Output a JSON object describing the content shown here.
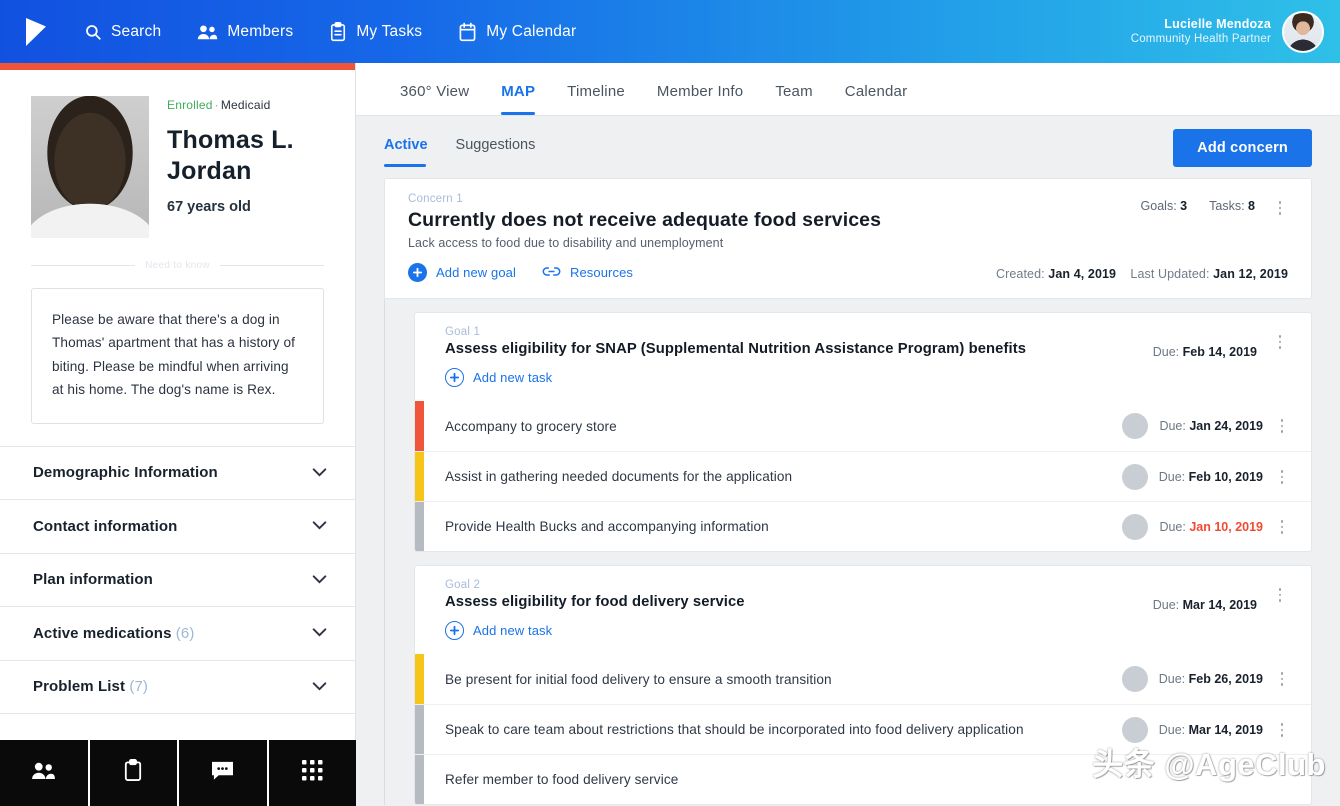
{
  "header": {
    "logo_icon": "flag-logo-icon",
    "nav": [
      {
        "label": "Search",
        "icon": "search-icon"
      },
      {
        "label": "Members",
        "icon": "members-icon"
      },
      {
        "label": "My Tasks",
        "icon": "clipboard-icon"
      },
      {
        "label": "My Calendar",
        "icon": "calendar-icon"
      }
    ],
    "user": {
      "name": "Lucielle Mendoza",
      "role": "Community Health Partner",
      "avatar": "user-avatar"
    },
    "gradient_start": "#1251e0",
    "gradient_end": "#2fc0e8"
  },
  "sidebar": {
    "accent_bar_color": "#f0543a",
    "profile": {
      "status": "Enrolled",
      "separator": "·",
      "plan": "Medicaid",
      "name": "Thomas L. Jordan",
      "age": "67 years old",
      "photo_alt": "member-photo"
    },
    "divider_label": "Need to know",
    "note": "Please be aware that there's a dog in Thomas' apartment that has a history of biting. Please be mindful when arriving at his home. The dog's name is Rex.",
    "accordion": [
      {
        "label": "Demographic Information",
        "count": ""
      },
      {
        "label": "Contact information",
        "count": ""
      },
      {
        "label": "Plan information",
        "count": ""
      },
      {
        "label": "Active medications",
        "count": "(6)"
      },
      {
        "label": "Problem List",
        "count": "(7)"
      }
    ],
    "bottom_nav": [
      {
        "icon": "members-icon"
      },
      {
        "icon": "clipboard-icon"
      },
      {
        "icon": "chat-icon"
      },
      {
        "icon": "grid-icon"
      }
    ]
  },
  "main": {
    "tabs": [
      {
        "label": "360° View",
        "active": false
      },
      {
        "label": "MAP",
        "active": true
      },
      {
        "label": "Timeline",
        "active": false
      },
      {
        "label": "Member Info",
        "active": false
      },
      {
        "label": "Team",
        "active": false
      },
      {
        "label": "Calendar",
        "active": false
      }
    ],
    "subtabs": [
      {
        "label": "Active",
        "active": true
      },
      {
        "label": "Suggestions",
        "active": false
      }
    ],
    "add_concern_label": "Add concern",
    "concern": {
      "kicker": "Concern 1",
      "title": "Currently does not receive adequate food services",
      "subtitle": "Lack access to food due to disability and unemployment",
      "add_goal_label": "Add new goal",
      "resources_label": "Resources",
      "goals_label": "Goals:",
      "goals_count": "3",
      "tasks_label": "Tasks:",
      "tasks_count": "8",
      "created_label": "Created:",
      "created_date": "Jan 4, 2019",
      "updated_label": "Last Updated:",
      "updated_date": "Jan 12, 2019"
    },
    "goals": [
      {
        "kicker": "Goal 1",
        "title": "Assess eligibility for SNAP (Supplemental Nutrition Assistance Program) benefits",
        "due_label": "Due:",
        "due_date": "Feb 14, 2019",
        "add_task_label": "Add new task",
        "tasks": [
          {
            "text": "Accompany to grocery store",
            "due_label": "Due:",
            "due_date": "Jan 24, 2019",
            "bar_color": "#f0543a",
            "overdue": false,
            "shirt": "#6b5a48"
          },
          {
            "text": "Assist in gathering needed documents for the application",
            "due_label": "Due:",
            "due_date": "Feb 10, 2019",
            "bar_color": "#f5c518",
            "overdue": false,
            "shirt": "#e01b1b"
          },
          {
            "text": "Provide Health Bucks and accompanying information",
            "due_label": "Due:",
            "due_date": "Jan 10, 2019",
            "bar_color": "#b6bbc1",
            "overdue": true,
            "shirt": "#6b5a48"
          }
        ]
      },
      {
        "kicker": "Goal 2",
        "title": "Assess eligibility for food delivery service",
        "due_label": "Due:",
        "due_date": "Mar 14, 2019",
        "add_task_label": "Add new task",
        "tasks": [
          {
            "text": "Be present for initial food delivery to ensure a smooth transition",
            "due_label": "Due:",
            "due_date": "Feb 26, 2019",
            "bar_color": "#f5c518",
            "overdue": false,
            "shirt": "#5a4a3a"
          },
          {
            "text": "Speak to care team about restrictions that should be incorporated into food delivery application",
            "due_label": "Due:",
            "due_date": "Mar 14, 2019",
            "bar_color": "#b6bbc1",
            "overdue": false,
            "shirt": "#5a4a3a"
          },
          {
            "text": "Refer member to food delivery service",
            "due_label": "",
            "due_date": "",
            "bar_color": "#b6bbc1",
            "overdue": false,
            "shirt": "#5a4a3a"
          }
        ]
      }
    ]
  },
  "watermark": "头条 @AgeClub"
}
